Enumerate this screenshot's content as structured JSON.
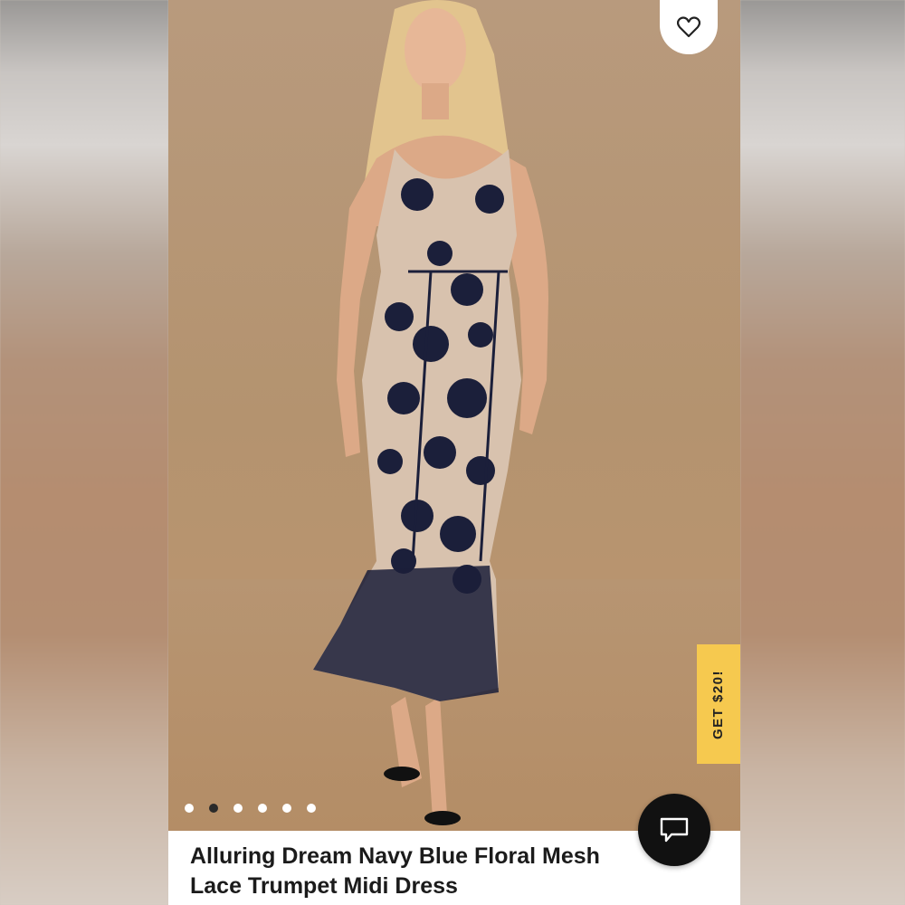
{
  "colors": {
    "photo_background": "#b4936f",
    "promo_tab": "#f6c94f",
    "chat_button": "#111111",
    "dress": "#1b1f3a",
    "dress_lining": "#d8c2ae"
  },
  "wishlist": {
    "icon": "heart-outline-icon"
  },
  "promo": {
    "label": "GET $20!"
  },
  "carousel": {
    "total": 6,
    "active_index": 1
  },
  "chat": {
    "icon": "chat-bubble-icon"
  },
  "product": {
    "title": "Alluring Dream Navy Blue Floral Mesh\nLace Trumpet Midi Dress"
  }
}
